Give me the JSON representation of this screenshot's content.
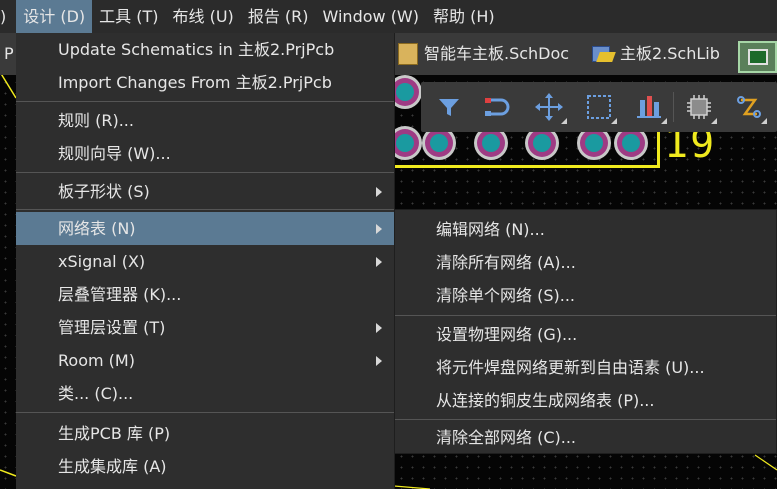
{
  "menubar": {
    "items": [
      {
        "label": ")"
      },
      {
        "label": "设计 (D)",
        "active": true
      },
      {
        "label": "工具 (T)"
      },
      {
        "label": "布线 (U)"
      },
      {
        "label": "报告 (R)"
      },
      {
        "label": "Window (W)"
      },
      {
        "label": "帮助 (H)"
      }
    ]
  },
  "tabs": {
    "left_clip": "P",
    "schdoc": "智能车主板.SchDoc",
    "schlib": "主板2.SchLib"
  },
  "board": {
    "designator": "19"
  },
  "design_menu": {
    "items": [
      "Update Schematics in 主板2.PrjPcb",
      "Import Changes From 主板2.PrjPcb",
      "规则 (R)...",
      "规则向导 (W)...",
      "板子形状 (S)",
      "网络表 (N)",
      "xSignal (X)",
      "层叠管理器 (K)...",
      "管理层设置 (T)",
      "Room (M)",
      "类... (C)...",
      "生成PCB 库 (P)",
      "生成集成库 (A)"
    ]
  },
  "netlist_submenu": {
    "items": [
      "编辑网络 (N)...",
      "清除所有网络 (A)...",
      "清除单个网络 (S)...",
      "设置物理网络 (G)...",
      "将元件焊盘网络更新到自由语素 (U)...",
      "从连接的铜皮生成网络表 (P)...",
      "清除全部网络 (C)..."
    ]
  },
  "colors": {
    "accent": "#5b7a93",
    "menu_bg": "#2e2e2e",
    "silkscreen": "#f0ea1e"
  },
  "toolbar_icons": [
    "filter-icon",
    "interactive-route-icon",
    "move-icon",
    "select-rect-icon",
    "align-icon",
    "component-icon",
    "route-path-icon"
  ]
}
